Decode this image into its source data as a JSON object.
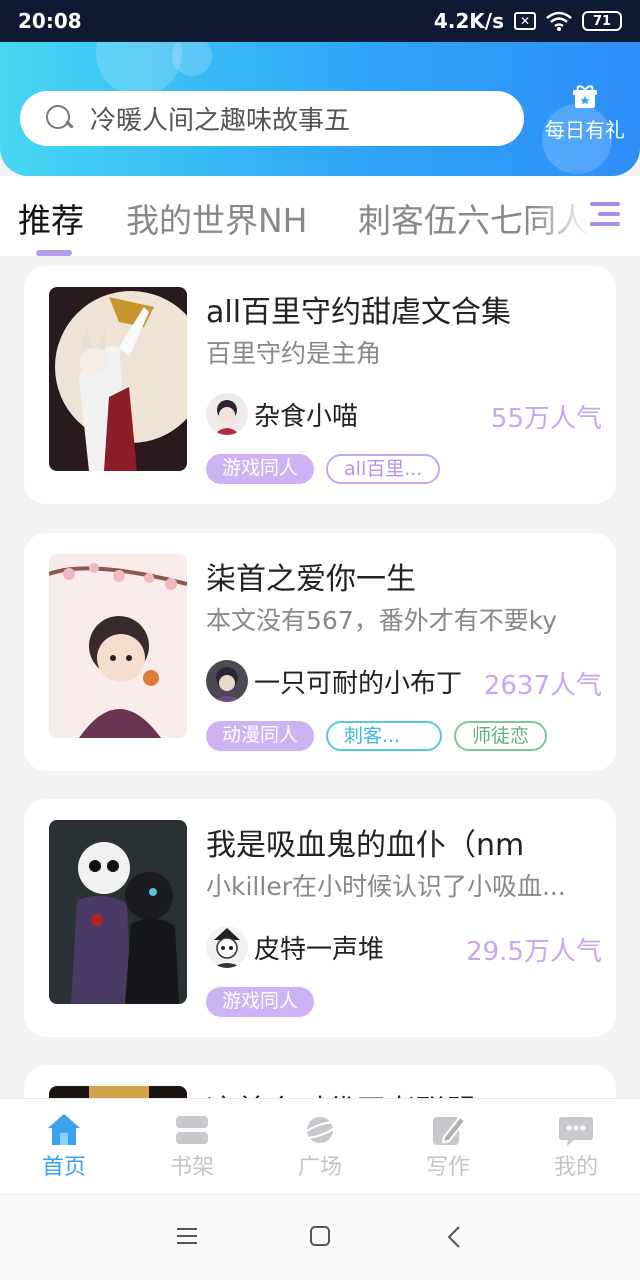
{
  "status_bar": {
    "time": "20:08",
    "speed": "4.2K/s",
    "sim_icon": "✕",
    "wifi_icon": "wifi-icon",
    "battery": "71"
  },
  "search": {
    "placeholder": "冷暖人间之趣味故事五"
  },
  "gift": {
    "label": "每日有礼",
    "icon": "gift-icon"
  },
  "tabs": [
    {
      "label": "推荐",
      "active": true
    },
    {
      "label": "我的世界NH",
      "active": false
    },
    {
      "label": "刺客伍六七同人",
      "active": false
    }
  ],
  "books": [
    {
      "title": "all百里守约甜虐文合集",
      "desc": "百里守约是主角",
      "author": "杂食小喵",
      "popularity": "55万人气",
      "tags": [
        {
          "label": "游戏同人",
          "style": "fill"
        },
        {
          "label": "all百里...",
          "style": "purple"
        }
      ]
    },
    {
      "title": "柒首之爱你一生",
      "desc": "本文没有567，番外才有不要ky",
      "author": "一只可耐的小布丁",
      "popularity": "2637人气",
      "tags": [
        {
          "label": "动漫同人",
          "style": "fill"
        },
        {
          "label": "刺客...",
          "style": "cyan"
        },
        {
          "label": "师徒恋",
          "style": "green"
        }
      ]
    },
    {
      "title": "我是吸血鬼的血仆（nm",
      "desc": "小killer在小时候认识了小吸血...",
      "author": "皮特一声堆",
      "popularity": "29.5万人气",
      "tags": [
        {
          "label": "游戏同人",
          "style": "fill"
        }
      ]
    },
    {
      "title": "这首个时代王者联盟",
      "desc": "",
      "author": "",
      "popularity": "",
      "tags": []
    }
  ],
  "bottom_nav": [
    {
      "label": "首页",
      "icon": "home-icon",
      "active": true
    },
    {
      "label": "书架",
      "icon": "bookshelf-icon",
      "active": false
    },
    {
      "label": "广场",
      "icon": "planet-icon",
      "active": false
    },
    {
      "label": "写作",
      "icon": "pen-icon",
      "active": false
    },
    {
      "label": "我的",
      "icon": "chat-bubble-icon",
      "active": false
    }
  ],
  "system_nav": {
    "menu": "☰",
    "home": "□",
    "back": "〈"
  },
  "colors": {
    "header_start": "#46d7f3",
    "header_end": "#2d8ef8",
    "accent_purple": "#cdb3f3",
    "nav_active": "#3aa2ee"
  }
}
